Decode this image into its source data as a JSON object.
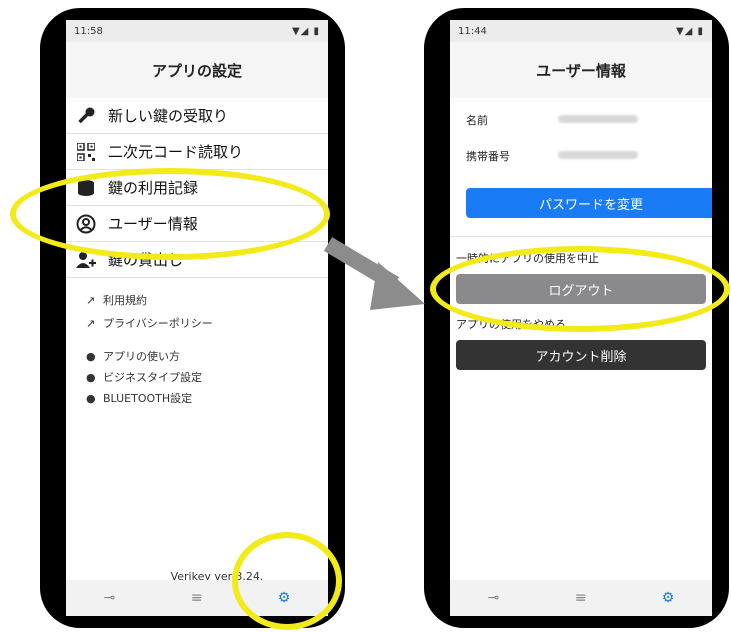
{
  "left": {
    "status_time": "11:58",
    "status_icons": "▼◢ ▮",
    "title": "アプリの設定",
    "menu": [
      {
        "label": "新しい鍵の受取り",
        "icon": "key-icon"
      },
      {
        "label": "二次元コード読取り",
        "icon": "qr-code-icon"
      },
      {
        "label": "鍵の利用記録",
        "icon": "database-icon"
      },
      {
        "label": "ユーザー情報",
        "icon": "user-circle-icon"
      },
      {
        "label": "鍵の貸出し",
        "icon": "user-add-icon"
      }
    ],
    "links": [
      {
        "label": "利用規約",
        "icon": "external-link-icon"
      },
      {
        "label": "プライバシーポリシー",
        "icon": "external-link-icon"
      }
    ],
    "settings": [
      {
        "label": "アプリの使い方",
        "icon": "play-circle-icon"
      },
      {
        "label": "ビジネスタイプ設定",
        "icon": "play-circle-icon"
      },
      {
        "label": "BLUETOOTH設定",
        "icon": "play-circle-icon"
      }
    ],
    "version": "Verikey ver-3.24."
  },
  "right": {
    "status_time": "11:44",
    "status_icons": "▼◢ ▮",
    "title": "ユーザー情報",
    "name_label": "名前",
    "phone_label": "携帯番号",
    "change_password": "パスワードを変更",
    "temp_stop_heading": "一時的にアプリの使用を中止",
    "logout": "ログアウト",
    "quit_heading": "アプリの使用をやめる",
    "delete_account": "アカウント削除"
  },
  "colors": {
    "primary_button": "#1a7cf5",
    "logout_button": "#8a8a8c",
    "delete_button": "#333333",
    "highlight": "#f3ea1a",
    "arrow": "#8c8c8c",
    "active_tab": "#1a73e8"
  }
}
